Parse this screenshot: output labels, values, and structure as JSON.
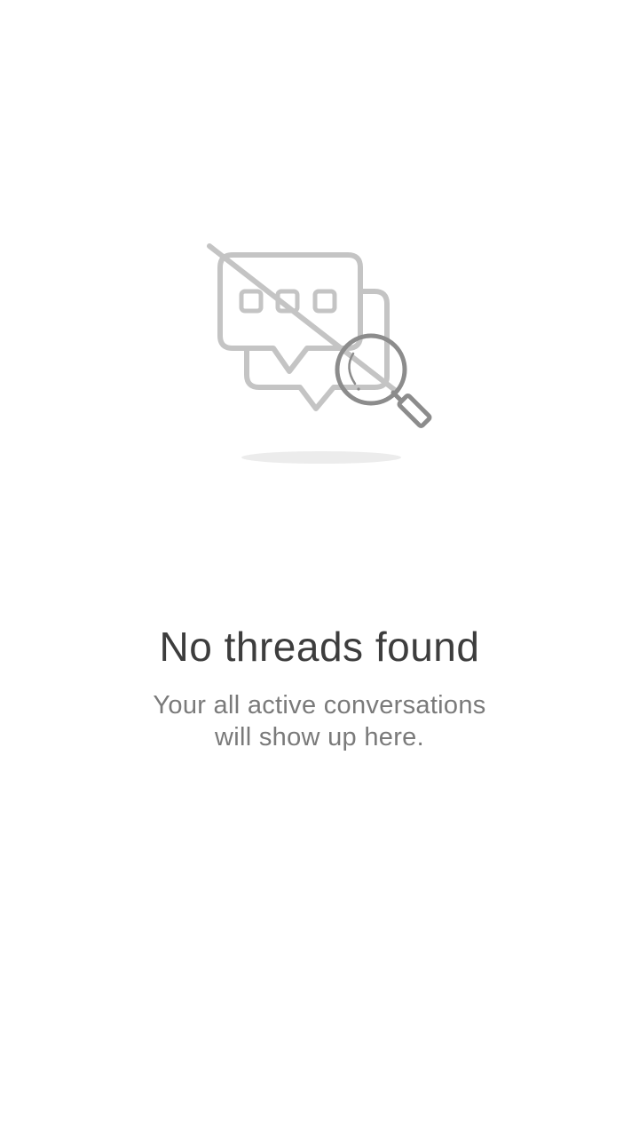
{
  "empty_state": {
    "title": "No threads found",
    "subtitle_lines": [
      "Your all active conversations",
      "will show up here."
    ],
    "illustration": {
      "icon": "no-conversations-search-icon",
      "colors": {
        "bubble_stroke": "#c4c4c4",
        "magnifier_stroke": "#8c8c8c",
        "shadow": "#ececec"
      }
    }
  },
  "colors": {
    "background": "#ffffff",
    "title": "#3d3d3d",
    "subtitle": "#7a7a7a"
  }
}
